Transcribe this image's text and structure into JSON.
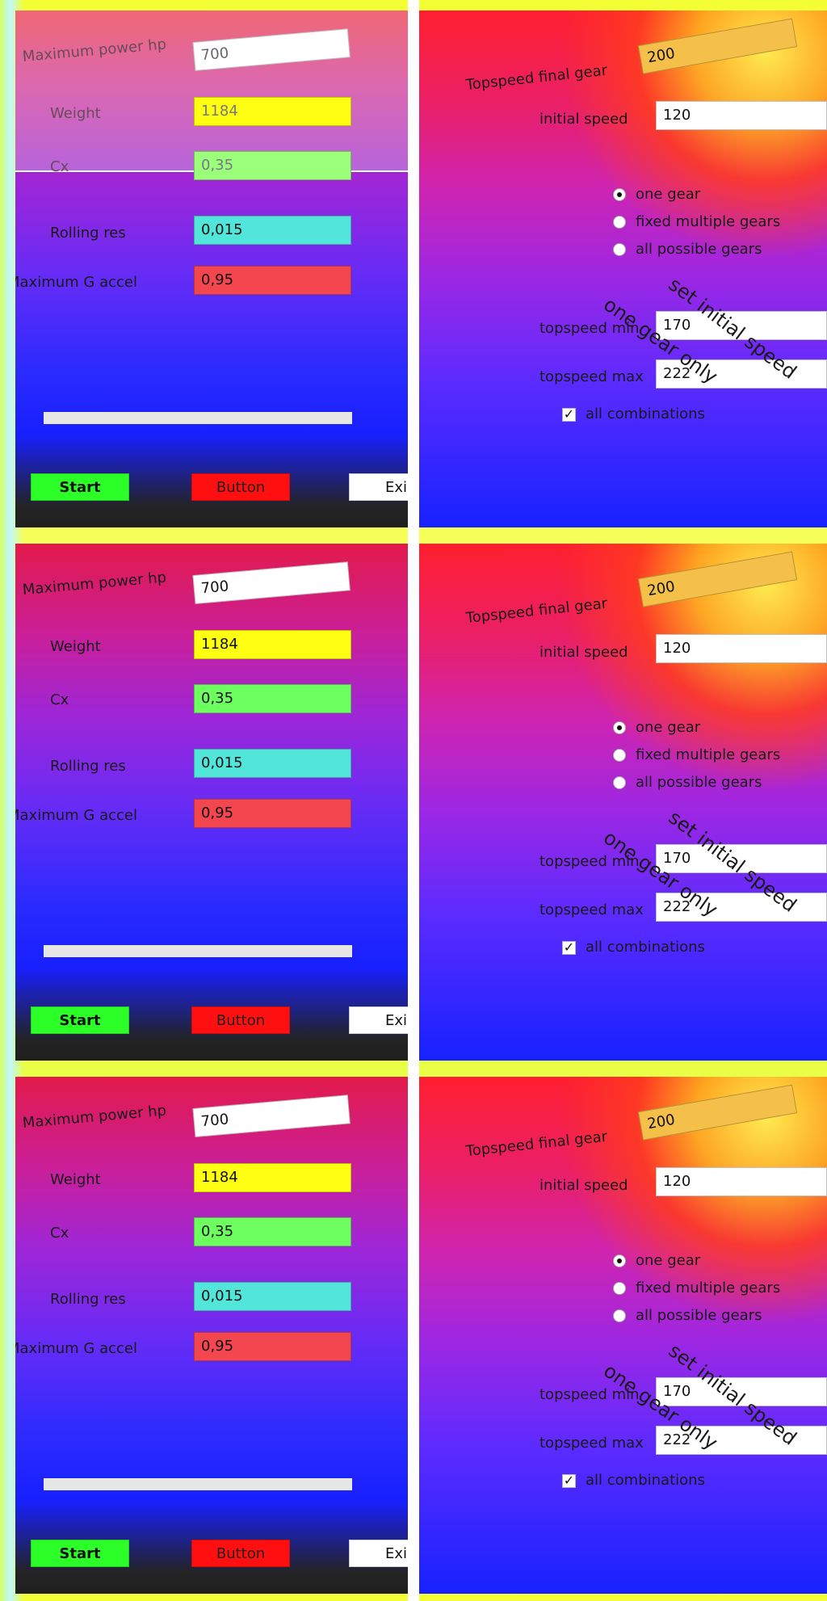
{
  "left_form": {
    "max_power_label": "Maximum power hp",
    "max_power_value": "700",
    "weight_label": "Weight",
    "weight_value": "1184",
    "cx_label": "Cx",
    "cx_value": "0,35",
    "rolling_label": "Rolling res",
    "rolling_value": "0,015",
    "max_g_label": "Maximum G accel",
    "max_g_value": "0,95",
    "start_label": "Start",
    "button_label": "Button",
    "exit_label": "Exi"
  },
  "right_form": {
    "topspeed_final_label": "Topspeed final gear",
    "topspeed_final_value": "200",
    "initial_speed_label": "initial speed",
    "initial_speed_value": "120",
    "radio_one": "one gear",
    "radio_fixed": "fixed multiple gears",
    "radio_all": "all possible gears",
    "topspeed_min_label": "topspeed min",
    "topspeed_min_value": "170",
    "topspeed_max_label": "topspeed max",
    "topspeed_max_value": "222",
    "set_initial_speed": "set initial speed",
    "one_gear_only": "one gear only",
    "all_combinations": "all combinations"
  },
  "colors": {
    "white_input": "#ffffff",
    "yellow_input": "#ffff12",
    "green_input": "#6cff5f",
    "cyan_input": "#52e5d9",
    "red_input": "#f3464e",
    "orange_input": "#f4c04a",
    "start_button": "#2cff28",
    "action_button": "#ff0f0f"
  },
  "icons": {
    "radio_selected": "radio-selected-icon",
    "radio_unselected": "radio-unselected-icon",
    "checkbox_checked": "check-icon"
  }
}
